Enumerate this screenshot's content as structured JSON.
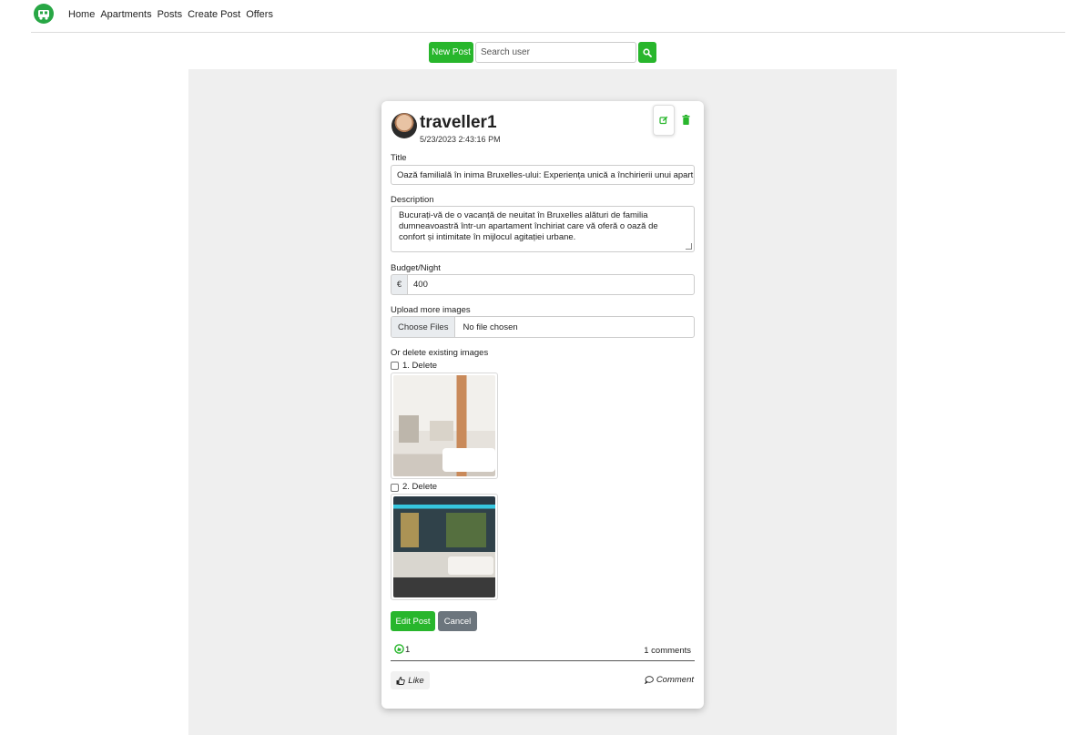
{
  "nav": {
    "logo_icon": "camper-logo-icon",
    "links": [
      "Home",
      "Apartments",
      "Posts",
      "Create Post",
      "Offers"
    ]
  },
  "toolbar": {
    "new_post_label": "New Post",
    "search_placeholder": "Search user",
    "search_icon": "search-icon"
  },
  "post": {
    "username": "traveller1",
    "timestamp": "5/23/2023 2:43:16 PM",
    "title_label": "Title",
    "title_value": "Oază familială în inima Bruxelles-ului: Experiența unică a închirierii unui apart",
    "description_label": "Description",
    "description_value": "Bucurați-vă de o vacanță de neuitat în Bruxelles alături de familia dumneavoastră într-un apartament închiriat care vă oferă o oază de confort și intimitate în mijlocul agitației urbane.",
    "budget_label": "Budget/Night",
    "currency_symbol": "€",
    "budget_value": "400",
    "upload_label": "Upload more images",
    "choose_files_label": "Choose Files",
    "no_file_label": "No file chosen",
    "delete_images_label": "Or delete existing images",
    "images": [
      {
        "delete_label": "1. Delete"
      },
      {
        "delete_label": "2. Delete"
      }
    ],
    "edit_post_label": "Edit Post",
    "cancel_label": "Cancel",
    "likes_count": "1",
    "comments_count": "1 comments",
    "like_label": "Like",
    "comment_label": "Comment"
  },
  "colors": {
    "accent": "#28b62c",
    "panel_bg": "#efefef",
    "cancel_bg": "#6c757d"
  }
}
